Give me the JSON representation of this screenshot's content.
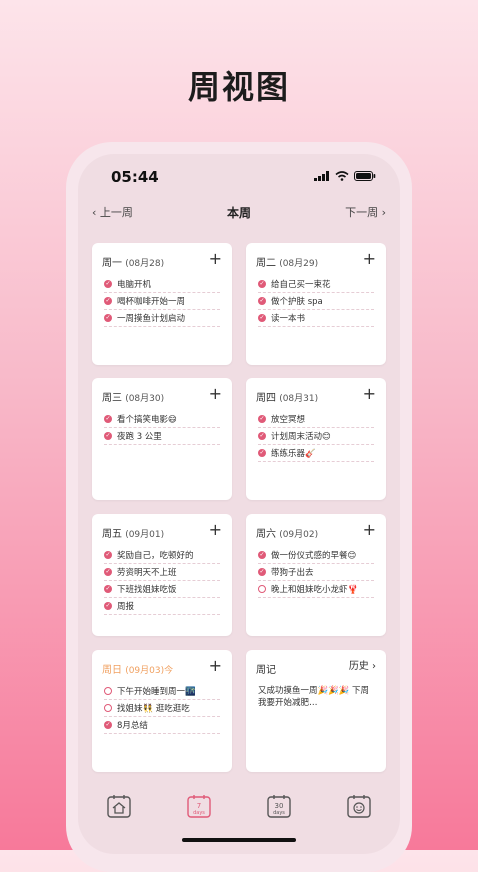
{
  "page_title": "周视图",
  "status_bar": {
    "time": "05:44",
    "icons": [
      "signal-icon",
      "wifi-icon",
      "battery-icon"
    ]
  },
  "nav": {
    "prev": "‹ 上一周",
    "title": "本周",
    "next": "下一周 ›"
  },
  "colors": {
    "accent": "#e05a78",
    "today": "#f0a060"
  },
  "days": [
    {
      "name": "周一",
      "date": "(08月28)",
      "add": "+",
      "tasks": [
        {
          "text": "电脑开机",
          "done": true
        },
        {
          "text": "喝杯咖啡开始一周",
          "done": true
        },
        {
          "text": "一周摸鱼计划启动",
          "done": true
        }
      ]
    },
    {
      "name": "周二",
      "date": "(08月29)",
      "add": "+",
      "tasks": [
        {
          "text": "给自己买一束花",
          "done": true
        },
        {
          "text": "做个护肤 spa",
          "done": true
        },
        {
          "text": "读一本书",
          "done": true
        }
      ]
    },
    {
      "name": "周三",
      "date": "(08月30)",
      "add": "+",
      "tasks": [
        {
          "text": "看个搞笑电影😄",
          "done": true
        },
        {
          "text": "夜跑 3 公里",
          "done": true
        }
      ]
    },
    {
      "name": "周四",
      "date": "(08月31)",
      "add": "+",
      "tasks": [
        {
          "text": "放空冥想",
          "done": true
        },
        {
          "text": "计划周末活动😊",
          "done": true
        },
        {
          "text": "练练乐器🎸",
          "done": true
        }
      ]
    },
    {
      "name": "周五",
      "date": "(09月01)",
      "add": "+",
      "tasks": [
        {
          "text": "奖励自己，吃顿好的",
          "done": true
        },
        {
          "text": "劳资明天不上班",
          "done": true
        },
        {
          "text": "下班找姐妹吃饭",
          "done": true
        },
        {
          "text": "周报",
          "done": true
        }
      ]
    },
    {
      "name": "周六",
      "date": "(09月02)",
      "add": "+",
      "tasks": [
        {
          "text": "做一份仪式感的早餐😊",
          "done": true
        },
        {
          "text": "带狗子出去",
          "done": true
        },
        {
          "text": "晚上和姐妹吃小龙虾🦞",
          "done": false
        }
      ]
    },
    {
      "name": "周日",
      "date": "(09月03)今",
      "add": "+",
      "today": true,
      "tasks": [
        {
          "text": "下午开始睡到周一🌃",
          "done": false
        },
        {
          "text": "找姐妹👯 逛吃逛吃",
          "done": false
        },
        {
          "text": "8月总结",
          "done": true
        }
      ]
    }
  ],
  "journal": {
    "title": "周记",
    "history": "历史 ›",
    "text": "又成功摸鱼一周🎉🎉🎉 下周我要开始减肥…"
  },
  "tab_bar": {
    "tabs": [
      {
        "name": "home-tab",
        "icon": "home-calendar-icon"
      },
      {
        "name": "week-tab",
        "icon": "7-days-calendar-icon",
        "label_top": "7",
        "label_bottom": "days",
        "active": true
      },
      {
        "name": "month-tab",
        "icon": "30-days-calendar-icon",
        "label_top": "30",
        "label_bottom": "days"
      },
      {
        "name": "mood-tab",
        "icon": "smiley-calendar-icon"
      }
    ]
  }
}
